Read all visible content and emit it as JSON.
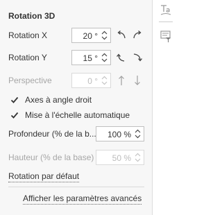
{
  "panel": {
    "title": "Rotation 3D",
    "rotation_x": {
      "label": "Rotation X",
      "value": "20 °"
    },
    "rotation_y": {
      "label": "Rotation Y",
      "value": "15 °"
    },
    "perspective": {
      "label": "Perspective",
      "value": "0 °"
    },
    "right_angle_axes": {
      "label": "Axes à angle droit",
      "checked": true
    },
    "autoscale": {
      "label": "Mise à l'échelle automatique",
      "checked": true
    },
    "depth": {
      "label": "Profondeur (% de la b...",
      "value": "100 %"
    },
    "height": {
      "label": "Hauteur (% de la base)",
      "value": "50 %"
    },
    "default_rotation": "Rotation par défaut",
    "advanced_settings": "Afficher les paramètres avancés"
  },
  "side_toolbar": {
    "icons": [
      "text-art-icon",
      "filter-icon"
    ]
  },
  "colors": {
    "panel_bg": "#f7f7f7",
    "border": "#c0c0c0",
    "disabled_text": "#a6a6a6",
    "text": "#333333"
  }
}
